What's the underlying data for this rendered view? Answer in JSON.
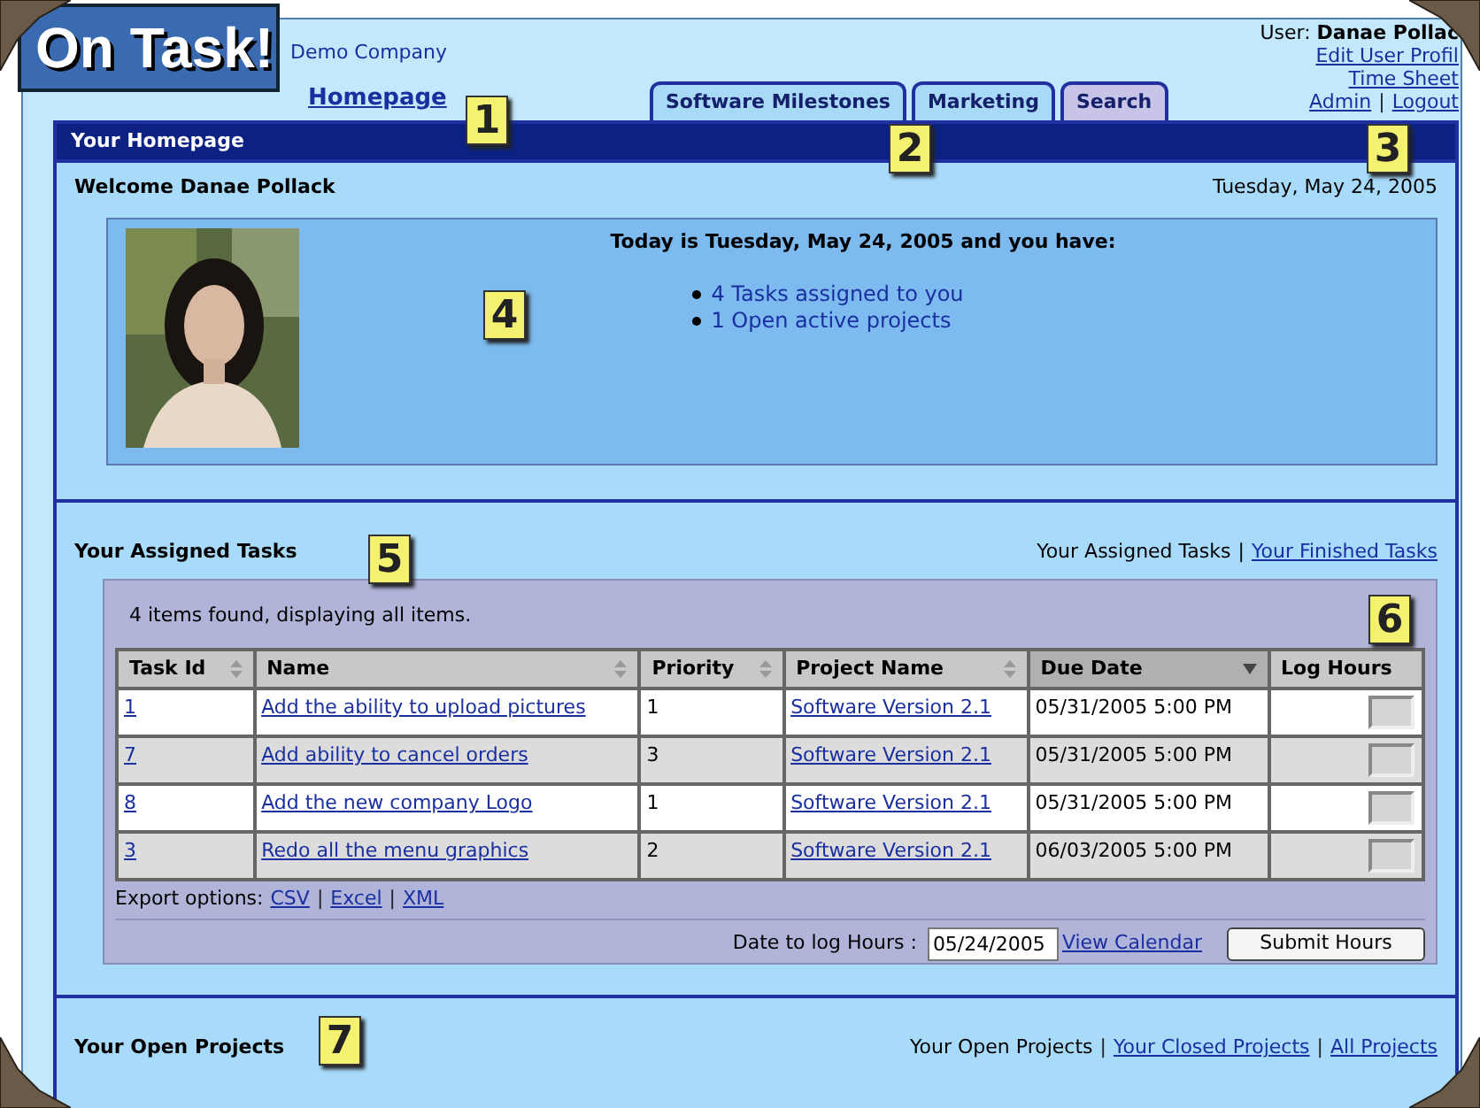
{
  "logo": {
    "text": "On Task!"
  },
  "company": "Demo Company",
  "home_link": "Homepage",
  "tabs": [
    {
      "label": "Software Milestones",
      "selected": false
    },
    {
      "label": "Marketing",
      "selected": false
    },
    {
      "label": "Search",
      "selected": true
    }
  ],
  "user": {
    "label": "User:",
    "name": "Danae Pollac",
    "links": [
      "Edit User Profil",
      "Time Sheet"
    ],
    "bottom_links": [
      {
        "kind": "link",
        "text": "Admin"
      },
      {
        "kind": "separator",
        "text": "|"
      },
      {
        "kind": "link",
        "text": "Logout"
      }
    ]
  },
  "title_bar": "Your Homepage",
  "welcome": {
    "title": "Welcome Danae Pollack",
    "date": "Tuesday, May 24, 2005",
    "photo": {
      "kind": "picture"
    },
    "heading": "Today is Tuesday, May 24, 2005 and you have:",
    "items": [
      "4 Tasks assigned to you",
      "1 Open active projects"
    ]
  },
  "tasks": {
    "title": "Your Assigned Tasks",
    "current": "Your Assigned Tasks",
    "separator": "|",
    "other_link": "Your Finished Tasks",
    "found": "4 items found, displaying all items.",
    "columns": [
      {
        "label": "Task Id",
        "sortable": true,
        "sorted": false
      },
      {
        "label": "Name",
        "sortable": true,
        "sorted": false
      },
      {
        "label": "Priority",
        "sortable": true,
        "sorted": false
      },
      {
        "label": "Project Name",
        "sortable": true,
        "sorted": false
      },
      {
        "label": "Due Date",
        "sortable": true,
        "sorted": true
      },
      {
        "label": "Log Hours",
        "sortable": false,
        "sorted": false
      }
    ],
    "rows": [
      {
        "id": "1",
        "name": "Add the ability to upload pictures",
        "priority": "1",
        "project": "Software Version 2.1",
        "due": "05/31/2005 5:00 PM"
      },
      {
        "id": "7",
        "name": "Add ability to cancel orders",
        "priority": "3",
        "project": "Software Version 2.1",
        "due": "05/31/2005 5:00 PM"
      },
      {
        "id": "8",
        "name": "Add the new company Logo",
        "priority": "1",
        "project": "Software Version 2.1",
        "due": "05/31/2005 5:00 PM"
      },
      {
        "id": "3",
        "name": "Redo all the menu graphics",
        "priority": "2",
        "project": "Software Version 2.1",
        "due": "06/03/2005 5:00 PM"
      }
    ],
    "export_label": "Export options:",
    "export_links": [
      {
        "kind": "link",
        "text": "CSV"
      },
      {
        "kind": "separator",
        "text": "|"
      },
      {
        "kind": "link",
        "text": "Excel"
      },
      {
        "kind": "separator",
        "text": "|"
      },
      {
        "kind": "link",
        "text": "XML"
      }
    ],
    "date_label": "Date to log Hours :",
    "date_value": "05/24/2005",
    "calendar_link": "View Calendar",
    "submit": "Submit Hours"
  },
  "projects": {
    "title": "Your Open Projects",
    "current": "Your Open Projects",
    "links": [
      {
        "kind": "separator",
        "text": "|"
      },
      {
        "kind": "link",
        "text": "Your Closed Projects"
      },
      {
        "kind": "separator",
        "text": "|"
      },
      {
        "kind": "link",
        "text": "All Projects"
      }
    ]
  },
  "callouts": [
    "1",
    "2",
    "3",
    "4",
    "5",
    "6",
    "7"
  ]
}
